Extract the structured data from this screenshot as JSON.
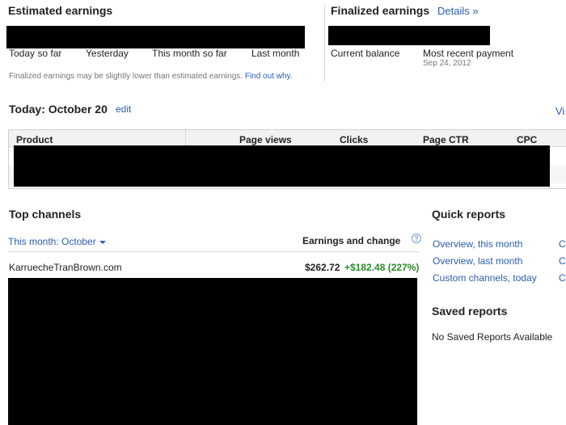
{
  "estimated": {
    "title": "Estimated earnings",
    "periods": [
      "Today so far",
      "Yesterday",
      "This month so far",
      "Last month"
    ],
    "note": "Finalized earnings may be slightly lower than estimated earnings.",
    "note_link": "Find out why."
  },
  "finalized": {
    "title": "Finalized earnings",
    "details_link": "Details »",
    "current_balance_label": "Current balance",
    "recent_payment_label": "Most recent payment",
    "recent_payment_date": "Sep 24, 2012"
  },
  "today": {
    "title": "Today: October 20",
    "edit_link": "edit",
    "view_link_partial": "Vi",
    "columns": [
      "Product",
      "Page views",
      "Clicks",
      "Page CTR",
      "CPC"
    ]
  },
  "top_channels": {
    "title": "Top channels",
    "period_dropdown": "This month: October",
    "earnings_header": "Earnings and change",
    "info_icon": "?",
    "rows": [
      {
        "name": "KarruecheTranBrown.com",
        "earnings": "$262.72",
        "change": "+$182.48 (227%)"
      }
    ]
  },
  "quick_reports": {
    "title": "Quick reports",
    "items": [
      "Overview, this month",
      "Overview, last month",
      "Custom channels, today"
    ],
    "trailing": [
      "C",
      "C",
      "C"
    ]
  },
  "saved_reports": {
    "title": "Saved reports",
    "empty_text": "No Saved Reports Available"
  },
  "colors": {
    "link": "#2a5db0",
    "positive": "#2c8a2c"
  }
}
